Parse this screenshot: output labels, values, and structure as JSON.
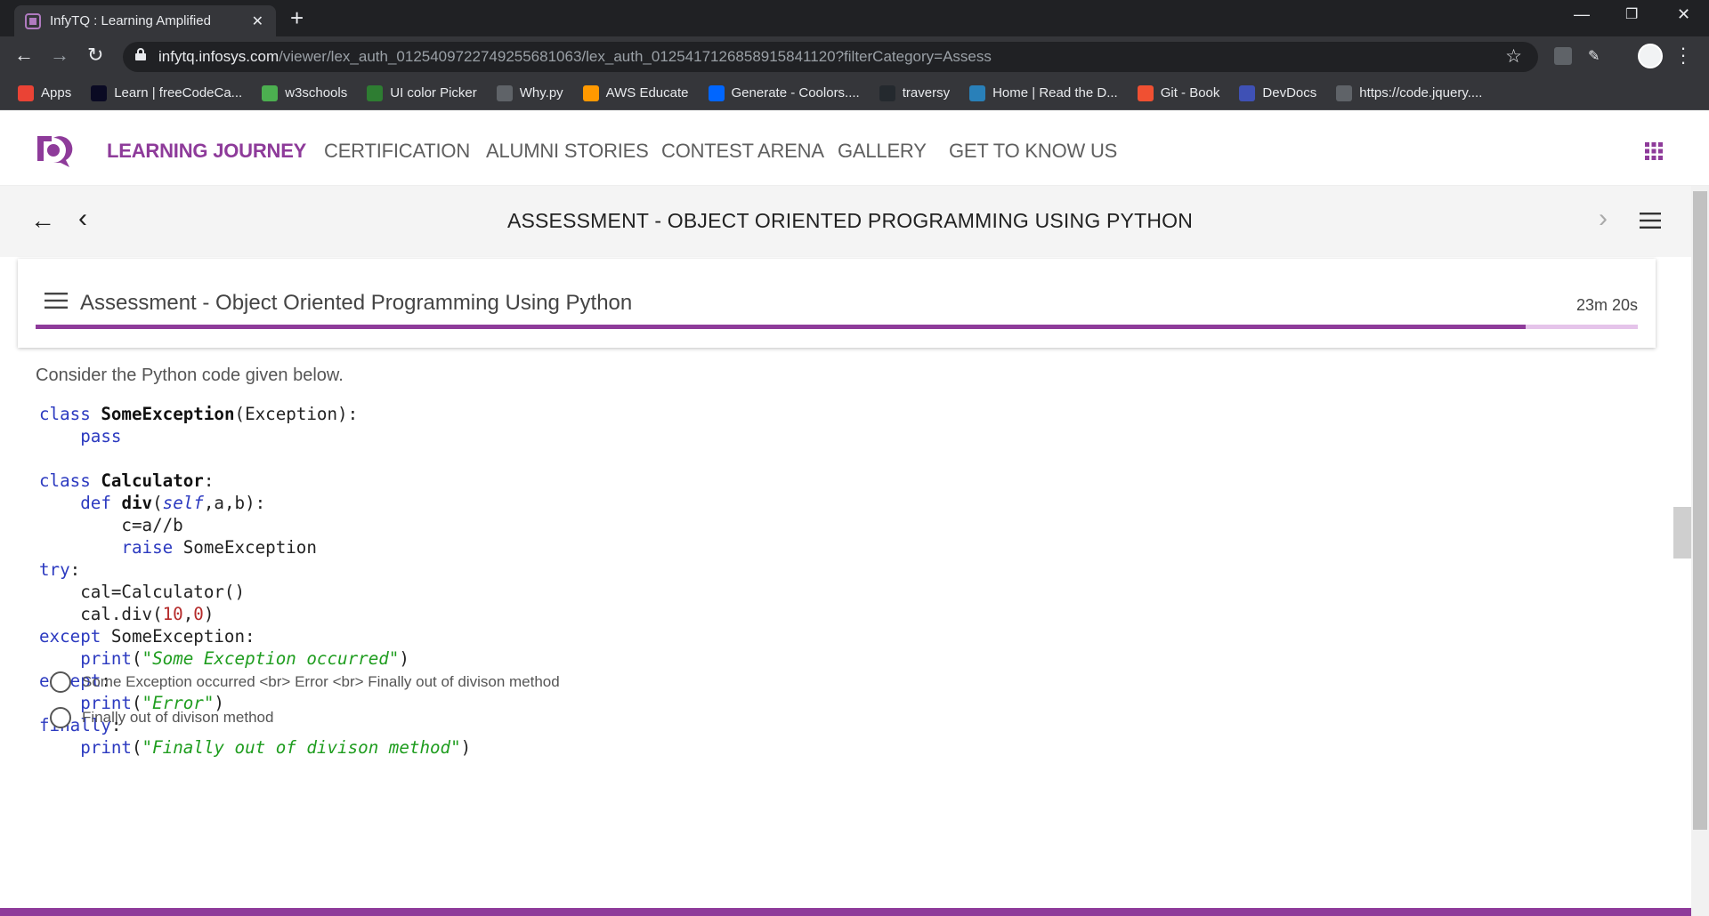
{
  "browser": {
    "tab_title": "InfyTQ : Learning Amplified",
    "url_host": "infytq.infosys.com",
    "url_path": "/viewer/lex_auth_012540972274925568106 3/lex_auth_01254171268589158411 20?filterCategory=Assess",
    "bookmarks": [
      {
        "label": "Apps",
        "icon": "apps-grid-icon",
        "color": "#ea4335"
      },
      {
        "label": "Learn | freeCodeCa...",
        "icon": "freecodecamp-icon",
        "color": "#0a0a23"
      },
      {
        "label": "w3schools",
        "icon": "w3schools-icon",
        "color": "#4caf50"
      },
      {
        "label": "UI color Picker",
        "icon": "color-picker-icon",
        "color": "#2e7d32"
      },
      {
        "label": "Why.py",
        "icon": "globe-icon",
        "color": "#5f6368"
      },
      {
        "label": "AWS Educate",
        "icon": "aws-icon",
        "color": "#ff9900"
      },
      {
        "label": "Generate - Coolors....",
        "icon": "coolors-icon",
        "color": "#0066ff"
      },
      {
        "label": "traversy",
        "icon": "github-icon",
        "color": "#24292e"
      },
      {
        "label": "Home | Read the D...",
        "icon": "readthedocs-icon",
        "color": "#2980b9"
      },
      {
        "label": "Git - Book",
        "icon": "git-icon",
        "color": "#f05032"
      },
      {
        "label": "DevDocs",
        "icon": "devdocs-icon",
        "color": "#3f51b5"
      },
      {
        "label": "https://code.jquery....",
        "icon": "globe-icon",
        "color": "#5f6368"
      }
    ]
  },
  "site_nav": {
    "items": [
      "LEARNING JOURNEY",
      "CERTIFICATION",
      "ALUMNI STORIES",
      "CONTEST ARENA",
      "GALLERY",
      "GET TO KNOW US"
    ],
    "active_color": "#8e3b9a"
  },
  "subheader": {
    "title": "ASSESSMENT - OBJECT ORIENTED PROGRAMMING USING PYTHON"
  },
  "assessment": {
    "title": "Assessment - Object Oriented Programming Using Python",
    "timer": "23m 20s",
    "progress": 0.93
  },
  "question": {
    "prompt": "Consider the Python code given below.",
    "code_lines": [
      [
        "class ",
        "SomeException",
        "(Exception):"
      ],
      [
        "    pass"
      ],
      [
        ""
      ],
      [
        "class ",
        "Calculator",
        ":"
      ],
      [
        "    def ",
        "div",
        "(",
        "self",
        ",a,b):"
      ],
      [
        "        c=a//b"
      ],
      [
        "        raise ",
        "SomeException"
      ],
      [
        "try:"
      ],
      [
        "    cal=Calculator()"
      ],
      [
        "    cal.div(",
        "10",
        ",",
        "0",
        ")"
      ],
      [
        "except ",
        "SomeException:"
      ],
      [
        "    print(",
        "\"Some Exception occurred\"",
        ")"
      ],
      [
        "except:"
      ],
      [
        "    print(",
        "\"Error\"",
        ")"
      ],
      [
        "finally:"
      ],
      [
        "    print(",
        "\"Finally out of divison method\"",
        ")"
      ]
    ],
    "options": [
      "Some Exception occurred <br> Error <br> Finally out of divison method",
      "Finally out of divison method"
    ]
  }
}
